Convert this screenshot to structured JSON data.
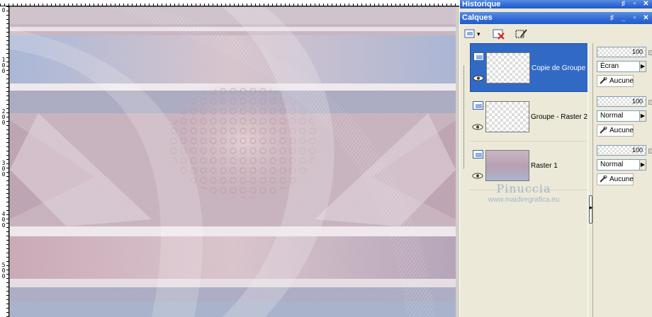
{
  "rulers": {
    "vertical_labels": [
      "0",
      "1 0 0",
      "2 0 0",
      "3 0 0",
      "4 0 0",
      "5 0 0"
    ]
  },
  "panels": {
    "history": {
      "title": "Historique",
      "btn_pin": "♯",
      "btn_restore": "▫",
      "btn_close": "✕"
    },
    "layers": {
      "title": "Calques",
      "btn_pin": "♯",
      "btn_min": "_",
      "btn_restore": "▫",
      "btn_close": "✕",
      "toolbar": {
        "new_layer_icon": "new-layer-icon",
        "delete_icon": "delete-layer-icon",
        "edit_icon": "edit-selection-icon",
        "dropdown_arrow": "▾"
      },
      "items": [
        {
          "name": "Copie de Groupe -",
          "selected": true,
          "opacity": "100",
          "blend": "Écran",
          "mask": "Aucune"
        },
        {
          "name": "Groupe - Raster 2",
          "selected": false,
          "opacity": "100",
          "blend": "Normal",
          "mask": "Aucune"
        },
        {
          "name": "Raster 1",
          "selected": false,
          "opacity": "100",
          "blend": "Normal",
          "mask": "Aucune"
        }
      ]
    }
  },
  "watermark": {
    "name": "Pinuccia",
    "url": "www.maidiregrafica.eu"
  },
  "colors": {
    "title_bar": "#2f6ad6",
    "selected_row": "#316ac5",
    "panel_bg": "#ece9d8"
  }
}
